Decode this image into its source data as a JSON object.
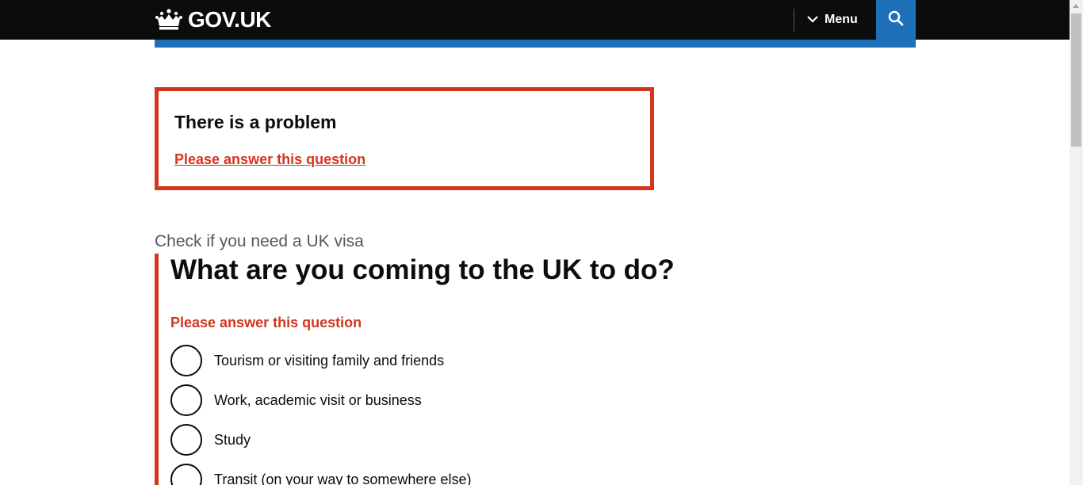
{
  "header": {
    "logo_text": "GOV.UK",
    "menu_label": "Menu"
  },
  "colors": {
    "header_bg": "#0b0c0c",
    "accent_blue": "#1d70b8",
    "error_red": "#d4351c",
    "caption_grey": "#505a5f"
  },
  "error_summary": {
    "title": "There is a problem",
    "link": "Please answer this question"
  },
  "form": {
    "caption": "Check if you need a UK visa",
    "question": "What are you coming to the UK to do?",
    "error_message": "Please answer this question",
    "options": [
      {
        "label": "Tourism or visiting family and friends"
      },
      {
        "label": "Work, academic visit or business"
      },
      {
        "label": "Study"
      },
      {
        "label": "Transit (on your way to somewhere else)"
      }
    ]
  }
}
